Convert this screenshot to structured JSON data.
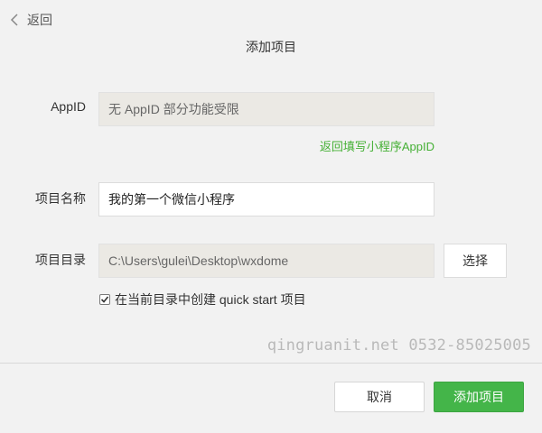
{
  "header": {
    "back_label": "返回",
    "title": "添加项目"
  },
  "form": {
    "appid": {
      "label": "AppID",
      "value": "无 AppID 部分功能受限",
      "link": "返回填写小程序AppID"
    },
    "project_name": {
      "label": "项目名称",
      "value": "我的第一个微信小程序"
    },
    "project_dir": {
      "label": "项目目录",
      "value": "C:\\Users\\gulei\\Desktop\\wxdome",
      "choose_label": "选择"
    },
    "quickstart": {
      "checked": true,
      "label": "在当前目录中创建 quick start 项目"
    }
  },
  "watermark": "qingruanit.net 0532-85025005",
  "footer": {
    "cancel_label": "取消",
    "add_label": "添加项目"
  },
  "colors": {
    "accent": "#44b549",
    "link": "#45b035",
    "background": "#f2f2f2",
    "disabled_field": "#ebe9e4"
  }
}
